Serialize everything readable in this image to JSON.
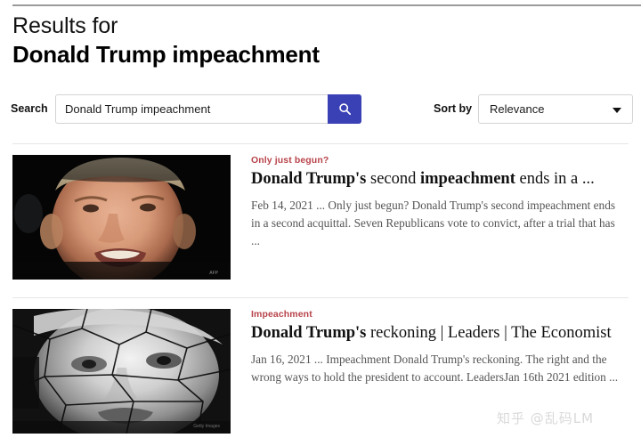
{
  "header": {
    "results_for": "Results for",
    "query": "Donald Trump impeachment"
  },
  "search": {
    "label": "Search",
    "value": "Donald Trump impeachment",
    "placeholder": "Search",
    "button_icon": "search-icon",
    "button_color": "#3a41b5"
  },
  "sort": {
    "label": "Sort by",
    "selected": "Relevance",
    "caret_icon": "chevron-down-icon"
  },
  "results": [
    {
      "kicker": "Only just begun?",
      "title_parts": [
        {
          "text": "Donald Trump's",
          "bold": true
        },
        {
          "text": " second ",
          "bold": false
        },
        {
          "text": "impeachment",
          "bold": true
        },
        {
          "text": " ends in a ...",
          "bold": false
        }
      ],
      "title_plain": "Donald Trump's second impeachment ends in a ...",
      "snippet": "Feb 14, 2021 ... Only just begun? Donald Trump's second impeachment ends in a second acquittal. Seven Republicans vote to convict, after a trial that has ...",
      "thumbnail_alt": "donald-trump-closeup-photo",
      "thumbnail_credit": "AFP"
    },
    {
      "kicker": "Impeachment",
      "title_parts": [
        {
          "text": "Donald Trump's",
          "bold": true
        },
        {
          "text": " reckoning | Leaders | The Economist",
          "bold": false
        }
      ],
      "title_plain": "Donald Trump's reckoning | Leaders | The Economist",
      "snippet": "Jan 16, 2021 ... Impeachment Donald Trump's reckoning. The right and the wrong ways to hold the president to account. LeadersJan 16th 2021 edition ...",
      "thumbnail_alt": "cracked-stone-trump-face-illustration",
      "thumbnail_credit": "Getty Images"
    }
  ],
  "watermark": {
    "text": "知乎 @乱码LM"
  },
  "colors": {
    "kicker_red": "#b8434a",
    "accent_blue": "#3a41b5",
    "divider": "#e6e6e6",
    "top_rule": "#9a9a9a"
  }
}
